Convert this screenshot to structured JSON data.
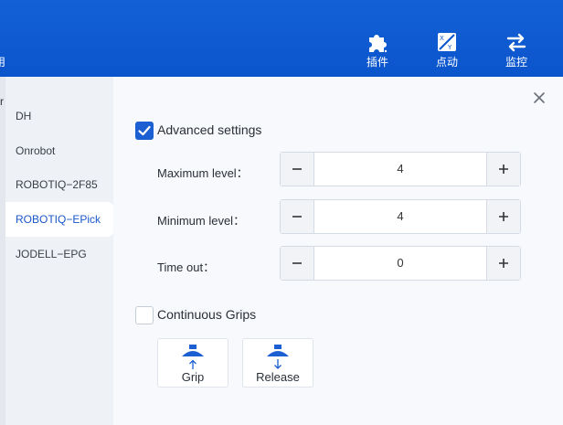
{
  "topbar": {
    "left_partial_label": "用",
    "buttons": [
      {
        "icon": "puzzle-icon",
        "label": "插件"
      },
      {
        "icon": "jog-icon",
        "label": "点动"
      },
      {
        "icon": "transfer-arrows-icon",
        "label": "监控"
      }
    ]
  },
  "left_strip": {
    "edge_text": "r"
  },
  "sidebar": {
    "items": [
      {
        "label": "DH",
        "active": false
      },
      {
        "label": "Onrobot",
        "active": false
      },
      {
        "label": "ROBOTIQ−2F85",
        "active": false
      },
      {
        "label": "ROBOTIQ−EPick",
        "active": true
      },
      {
        "label": "JODELL−EPG",
        "active": false
      }
    ]
  },
  "panel": {
    "advanced_settings": {
      "label": "Advanced settings",
      "checked": true
    },
    "fields": [
      {
        "label": "Maximum level：",
        "value": "4"
      },
      {
        "label": "Minimum level：",
        "value": "4"
      },
      {
        "label": "Time out：",
        "value": "0"
      }
    ],
    "continuous_grips": {
      "label": "Continuous Grips",
      "checked": false
    },
    "grip_button": {
      "label": "Grip"
    },
    "release_button": {
      "label": "Release"
    }
  },
  "colors": {
    "topbar": "#0b55cc",
    "accent": "#1b5fd2",
    "active_text": "#1a57c9",
    "grip_icon": "#1b5fd2"
  }
}
